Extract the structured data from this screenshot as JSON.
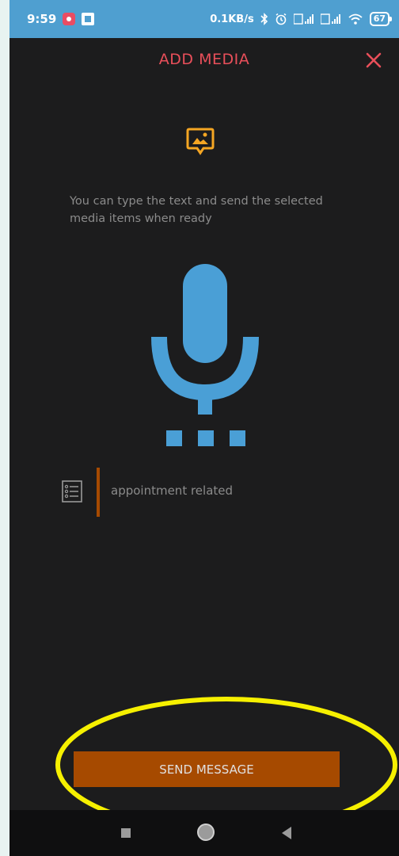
{
  "status_bar": {
    "time": "9:59",
    "network_speed": "0.1KB/s",
    "battery_level": "67",
    "icons": [
      "notification-icon",
      "app-icon",
      "bluetooth-icon",
      "alarm-icon",
      "signal-icon",
      "signal-icon",
      "wifi-icon",
      "battery-icon"
    ]
  },
  "dialog": {
    "title": "ADD MEDIA",
    "close_icon": "close-icon",
    "media_icon": "image-message-icon",
    "description": "You can type the text and send the selected media items when ready",
    "mic_icon": "microphone-icon",
    "note_icon": "list-icon",
    "note_text": "appointment related",
    "send_label": "SEND MESSAGE"
  },
  "nav_bar": {
    "icons": [
      "recents-icon",
      "home-icon",
      "back-icon"
    ]
  },
  "colors": {
    "accent_red": "#e94f5a",
    "accent_orange": "#f5a623",
    "mic_blue": "#4a9fd6",
    "button_brown": "#a64a00",
    "status_bar_blue": "#4f9fd0",
    "background": "#1c1c1d",
    "annotation_yellow": "#f6f000"
  }
}
